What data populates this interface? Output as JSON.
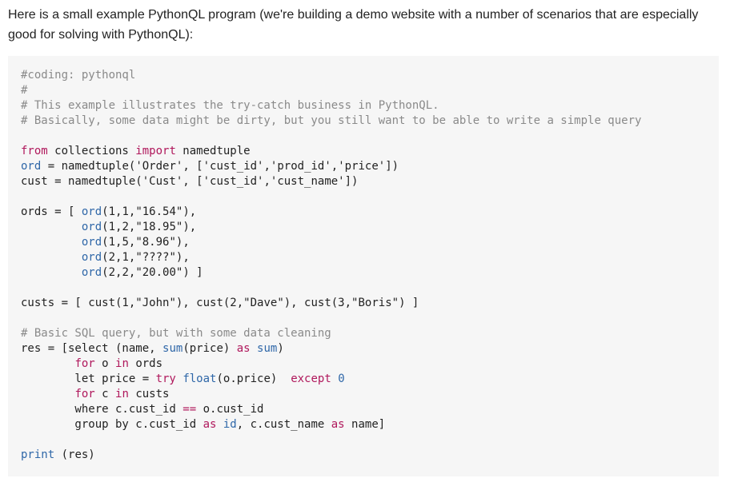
{
  "intro": {
    "text": "Here is a small example PythonQL program (we're building a demo website with a number of scenarios that are especially good for solving with PythonQL):"
  },
  "code": {
    "lines": [
      [
        [
          "c",
          "#coding: pythonql"
        ]
      ],
      [
        [
          "c",
          "#"
        ]
      ],
      [
        [
          "c",
          "# This example illustrates the try-catch business in PythonQL."
        ]
      ],
      [
        [
          "c",
          "# Basically, some data might be dirty, but you still want to be able to write a simple query"
        ]
      ],
      [],
      [
        [
          "k",
          "from"
        ],
        [
          "p",
          " collections "
        ],
        [
          "k",
          "import"
        ],
        [
          "p",
          " namedtuple"
        ]
      ],
      [
        [
          "b",
          "ord"
        ],
        [
          "p",
          " = namedtuple("
        ],
        [
          "s",
          "'Order'"
        ],
        [
          "p",
          ", ["
        ],
        [
          "s",
          "'cust_id'"
        ],
        [
          "p",
          ","
        ],
        [
          "s",
          "'prod_id'"
        ],
        [
          "p",
          ","
        ],
        [
          "s",
          "'price'"
        ],
        [
          "p",
          "])"
        ]
      ],
      [
        [
          "p",
          "cust = namedtuple("
        ],
        [
          "s",
          "'Cust'"
        ],
        [
          "p",
          ", ["
        ],
        [
          "s",
          "'cust_id'"
        ],
        [
          "p",
          ","
        ],
        [
          "s",
          "'cust_name'"
        ],
        [
          "p",
          "])"
        ]
      ],
      [],
      [
        [
          "p",
          "ords = [ "
        ],
        [
          "b",
          "ord"
        ],
        [
          "p",
          "(1,1,"
        ],
        [
          "s",
          "\"16.54\""
        ],
        [
          "p",
          "),"
        ]
      ],
      [
        [
          "p",
          "         "
        ],
        [
          "b",
          "ord"
        ],
        [
          "p",
          "(1,2,"
        ],
        [
          "s",
          "\"18.95\""
        ],
        [
          "p",
          "),"
        ]
      ],
      [
        [
          "p",
          "         "
        ],
        [
          "b",
          "ord"
        ],
        [
          "p",
          "(1,5,"
        ],
        [
          "s",
          "\"8.96\""
        ],
        [
          "p",
          "),"
        ]
      ],
      [
        [
          "p",
          "         "
        ],
        [
          "b",
          "ord"
        ],
        [
          "p",
          "(2,1,"
        ],
        [
          "s",
          "\"????\""
        ],
        [
          "p",
          "),"
        ]
      ],
      [
        [
          "p",
          "         "
        ],
        [
          "b",
          "ord"
        ],
        [
          "p",
          "(2,2,"
        ],
        [
          "s",
          "\"20.00\""
        ],
        [
          "p",
          ") ]"
        ]
      ],
      [],
      [
        [
          "p",
          "custs = [ cust(1,"
        ],
        [
          "s",
          "\"John\""
        ],
        [
          "p",
          "), cust(2,"
        ],
        [
          "s",
          "\"Dave\""
        ],
        [
          "p",
          "), cust(3,"
        ],
        [
          "s",
          "\"Boris\""
        ],
        [
          "p",
          ") ]"
        ]
      ],
      [],
      [
        [
          "c",
          "# Basic SQL query, but with some data cleaning"
        ]
      ],
      [
        [
          "p",
          "res = [select (name, "
        ],
        [
          "b",
          "sum"
        ],
        [
          "p",
          "(price) "
        ],
        [
          "k",
          "as"
        ],
        [
          "p",
          " "
        ],
        [
          "b",
          "sum"
        ],
        [
          "p",
          ")"
        ]
      ],
      [
        [
          "p",
          "        "
        ],
        [
          "k",
          "for"
        ],
        [
          "p",
          " o "
        ],
        [
          "k",
          "in"
        ],
        [
          "p",
          " ords"
        ]
      ],
      [
        [
          "p",
          "        let price = "
        ],
        [
          "k",
          "try"
        ],
        [
          "p",
          " "
        ],
        [
          "b",
          "float"
        ],
        [
          "p",
          "(o.price)  "
        ],
        [
          "k",
          "except"
        ],
        [
          "p",
          " "
        ],
        [
          "n",
          "0"
        ]
      ],
      [
        [
          "p",
          "        "
        ],
        [
          "k",
          "for"
        ],
        [
          "p",
          " c "
        ],
        [
          "k",
          "in"
        ],
        [
          "p",
          " custs"
        ]
      ],
      [
        [
          "p",
          "        where c.cust_id "
        ],
        [
          "k",
          "=="
        ],
        [
          "p",
          " o.cust_id"
        ]
      ],
      [
        [
          "p",
          "        group by c.cust_id "
        ],
        [
          "k",
          "as"
        ],
        [
          "p",
          " "
        ],
        [
          "b",
          "id"
        ],
        [
          "p",
          ", c.cust_name "
        ],
        [
          "k",
          "as"
        ],
        [
          "p",
          " name]"
        ]
      ],
      [],
      [
        [
          "b",
          "print"
        ],
        [
          "p",
          " (res)"
        ]
      ]
    ]
  }
}
